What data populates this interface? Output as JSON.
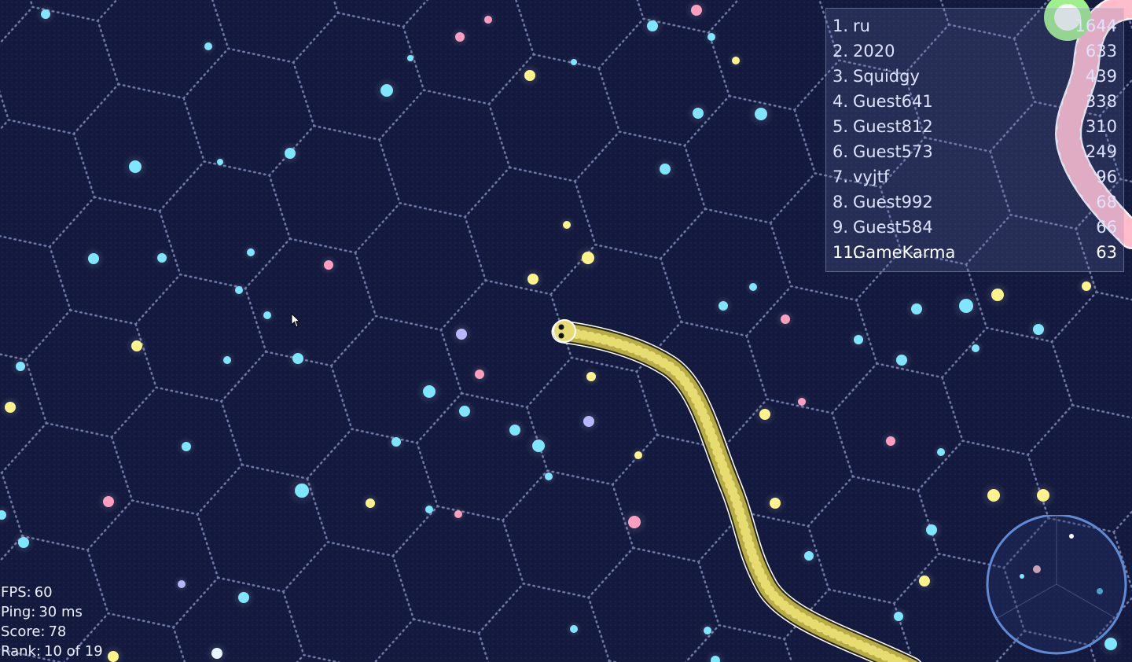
{
  "stats": {
    "fps_label": "FPS:",
    "fps_value": "60",
    "ping_label": "Ping:",
    "ping_value": "30 ms",
    "score_label": "Score:",
    "score_value": "78",
    "rank_label": "Rank:",
    "rank_value": "10 of 19"
  },
  "leaderboard": [
    {
      "rank": "1.",
      "name": "ru",
      "score": "1644"
    },
    {
      "rank": "2.",
      "name": "2020",
      "score": "633"
    },
    {
      "rank": "3.",
      "name": "Squidgy",
      "score": "439"
    },
    {
      "rank": "4.",
      "name": "Guest641",
      "score": "338"
    },
    {
      "rank": "5.",
      "name": "Guest812",
      "score": "310"
    },
    {
      "rank": "6.",
      "name": "Guest573",
      "score": "249"
    },
    {
      "rank": "7.",
      "name": "vyjtf",
      "score": "96"
    },
    {
      "rank": "8.",
      "name": "Guest992",
      "score": "68"
    },
    {
      "rank": "9.",
      "name": "Guest584",
      "score": "66"
    },
    {
      "rank": "11.",
      "name": "GameKarma",
      "score": "63"
    }
  ],
  "colors": {
    "background": "#131a3e",
    "grid": "#8f9ac8",
    "player_snake": "#e6dc72",
    "enemy_snake_pink": "#ffd6e0",
    "enemy_snake_green": "#9ef08a",
    "food_cyan": "#7fe6ff",
    "food_yellow": "#fff38a",
    "food_pink": "#ff9fbd",
    "food_lavender": "#b7b6ff",
    "minimap_ring": "#5f8bd6"
  }
}
